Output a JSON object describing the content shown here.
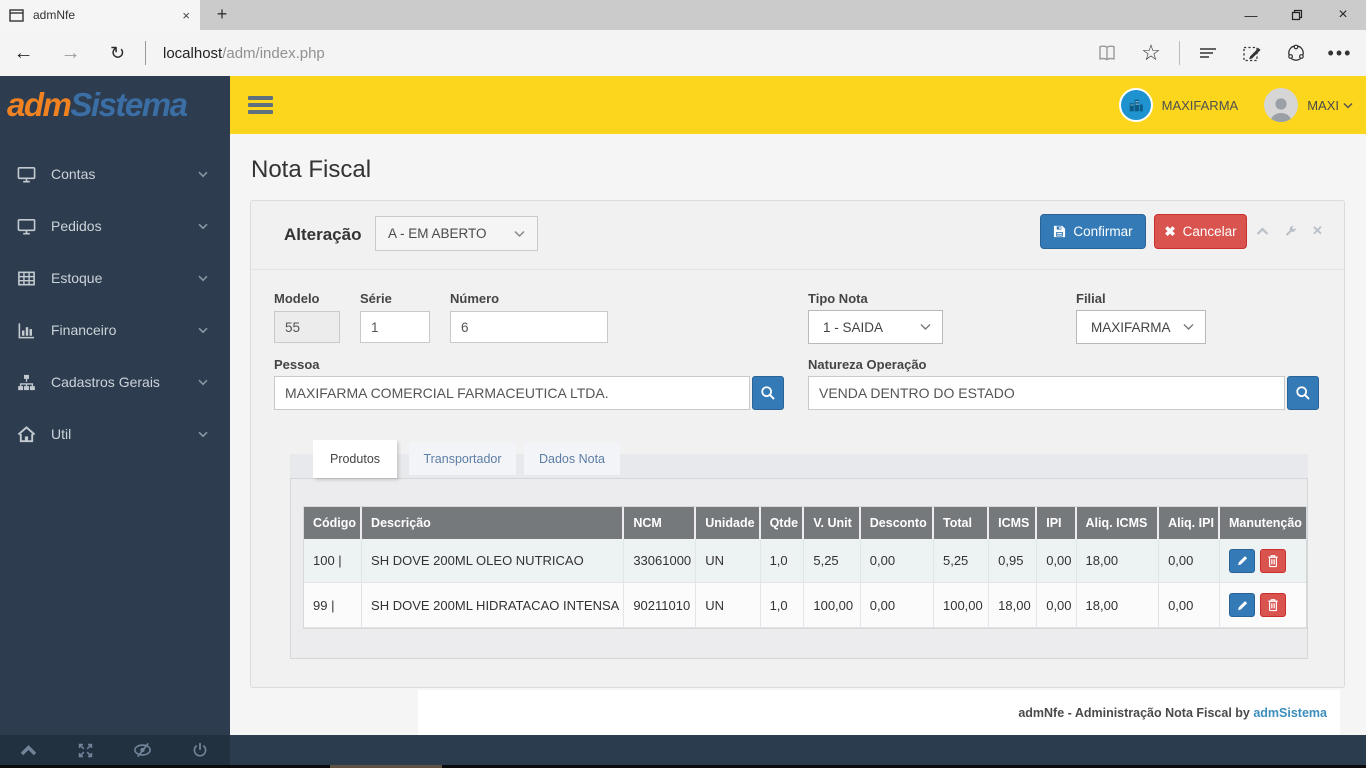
{
  "browser": {
    "tab_title": "admNfe",
    "new_tab_glyph": "+",
    "url_host": "localhost",
    "url_path": "/adm/index.php"
  },
  "brand": {
    "logo_part1": "adm",
    "logo_part2": "Sistema"
  },
  "topbar": {
    "company": "MAXIFARMA",
    "user": "MAXI"
  },
  "sidebar": {
    "items": [
      {
        "label": "Contas",
        "icon": "desktop-icon"
      },
      {
        "label": "Pedidos",
        "icon": "desktop-icon"
      },
      {
        "label": "Estoque",
        "icon": "table-icon"
      },
      {
        "label": "Financeiro",
        "icon": "bar-chart-icon"
      },
      {
        "label": "Cadastros Gerais",
        "icon": "sitemap-icon"
      },
      {
        "label": "Util",
        "icon": "home-icon"
      }
    ]
  },
  "page": {
    "title": "Nota Fiscal"
  },
  "panel": {
    "mode_label": "Alteração",
    "status_value": "A - EM ABERTO",
    "confirm_label": "Confirmar",
    "cancel_label": "Cancelar"
  },
  "form": {
    "modelo_label": "Modelo",
    "modelo_value": "55",
    "serie_label": "Série",
    "serie_value": "1",
    "numero_label": "Número",
    "numero_value": "6",
    "tipo_nota_label": "Tipo Nota",
    "tipo_nota_value": "1 - SAIDA",
    "filial_label": "Filial",
    "filial_value": "MAXIFARMA",
    "pessoa_label": "Pessoa",
    "pessoa_value": "MAXIFARMA COMERCIAL FARMACEUTICA LTDA.",
    "natureza_label": "Natureza Operação",
    "natureza_value": "VENDA DENTRO DO ESTADO"
  },
  "tabs": [
    {
      "label": "Produtos",
      "active": true
    },
    {
      "label": "Transportador",
      "active": false
    },
    {
      "label": "Dados Nota",
      "active": false
    }
  ],
  "table": {
    "columns": [
      "Código",
      "Descrição",
      "NCM",
      "Unidade",
      "Qtde",
      "V. Unit",
      "Desconto",
      "Total",
      "ICMS",
      "IPI",
      "Aliq. ICMS",
      "Aliq. IPI",
      "Manutenção"
    ],
    "rows": [
      [
        "100 |",
        "SH DOVE 200ML OLEO NUTRICAO",
        "33061000",
        "UN",
        "1,0",
        "5,25",
        "0,00",
        "5,25",
        "0,95",
        "0,00",
        "18,00",
        "0,00"
      ],
      [
        "99 |",
        "SH DOVE 200ML HIDRATACAO INTENSA",
        "90211010",
        "UN",
        "1,0",
        "100,00",
        "0,00",
        "100,00",
        "18,00",
        "0,00",
        "18,00",
        "0,00"
      ]
    ]
  },
  "footer": {
    "text": "admNfe - Administração Nota Fiscal by ",
    "link": "admSistema"
  },
  "colors": {
    "accent_blue": "#337ab7",
    "danger_red": "#d9534f",
    "header_yellow": "#fcd61d",
    "sidebar_navy": "#2d3c4e",
    "link_blue": "#3c8dbc",
    "table_header_gray": "#75797c"
  }
}
